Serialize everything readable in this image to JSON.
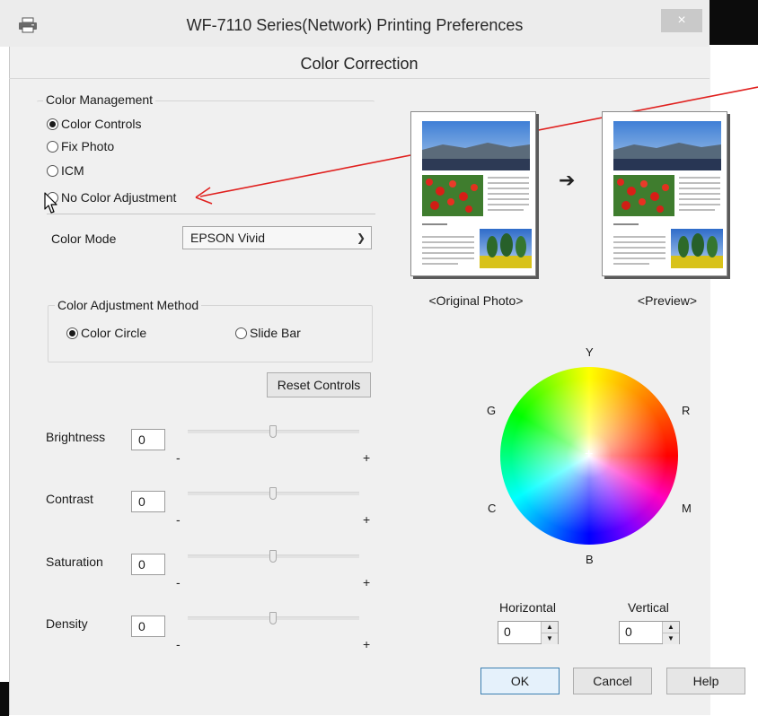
{
  "window": {
    "title": "WF-7110 Series(Network) Printing Preferences",
    "close_glyph": "×",
    "dialog_title": "Color Correction"
  },
  "color_management": {
    "label": "Color Management",
    "options": [
      "Color Controls",
      "Fix Photo",
      "ICM",
      "No Color Adjustment"
    ],
    "selected": "Color Controls"
  },
  "color_mode": {
    "label": "Color Mode",
    "value": "EPSON Vivid"
  },
  "adjustment_method": {
    "label": "Color Adjustment Method",
    "options": [
      "Color Circle",
      "Slide Bar"
    ],
    "selected": "Color Circle"
  },
  "reset_button": "Reset Controls",
  "sliders": [
    {
      "label": "Brightness",
      "value": "0",
      "level": 0.5,
      "minus": "-",
      "plus": "+"
    },
    {
      "label": "Contrast",
      "value": "0",
      "level": 0.5,
      "minus": "-",
      "plus": "+"
    },
    {
      "label": "Saturation",
      "value": "0",
      "level": 0.5,
      "minus": "-",
      "plus": "+"
    },
    {
      "label": "Density",
      "value": "0",
      "level": 0.5,
      "minus": "-",
      "plus": "+"
    }
  ],
  "previews": {
    "original_label": "<Original Photo>",
    "preview_label": "<Preview>",
    "arrow_glyph": "➔"
  },
  "color_circle": {
    "labels": {
      "top": "Y",
      "right_top": "R",
      "right_bottom": "M",
      "bottom": "B",
      "left_bottom": "C",
      "left_top": "G"
    },
    "center_glyph": "+"
  },
  "horizontal": {
    "label": "Horizontal",
    "value": "0"
  },
  "vertical": {
    "label": "Vertical",
    "value": "0"
  },
  "buttons": {
    "ok": "OK",
    "cancel": "Cancel",
    "help": "Help"
  },
  "colors": {
    "annotation_arrow": "#e0201e",
    "default_button_border": "#3c7fb1"
  }
}
